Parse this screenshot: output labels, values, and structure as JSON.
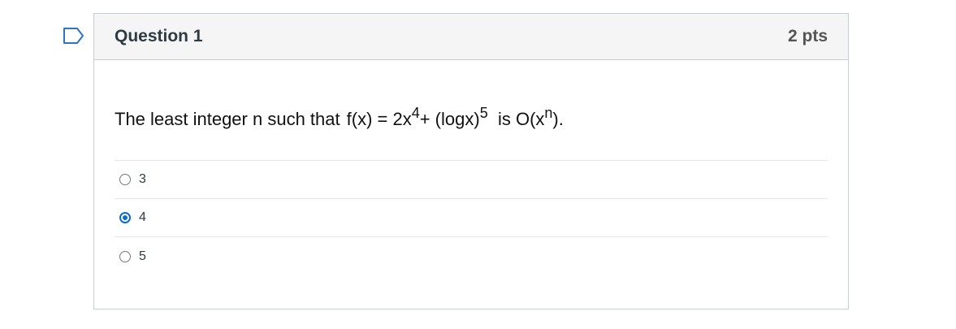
{
  "question": {
    "title": "Question 1",
    "points": "2 pts",
    "text_prefix": "The least integer n such that",
    "formula_a": "f(x) = 2x",
    "sup_a": "4",
    "formula_b": "+ (logx)",
    "sup_b": "5",
    "formula_c": "is O(x",
    "sup_c": "n",
    "formula_d": ")."
  },
  "answers": [
    {
      "label": "3",
      "selected": false
    },
    {
      "label": "4",
      "selected": true
    },
    {
      "label": "5",
      "selected": false
    }
  ],
  "colors": {
    "accent": "#0b6ad1",
    "flag_outline": "#2d73c7"
  },
  "icons": {
    "flag": "flag-question-icon"
  }
}
